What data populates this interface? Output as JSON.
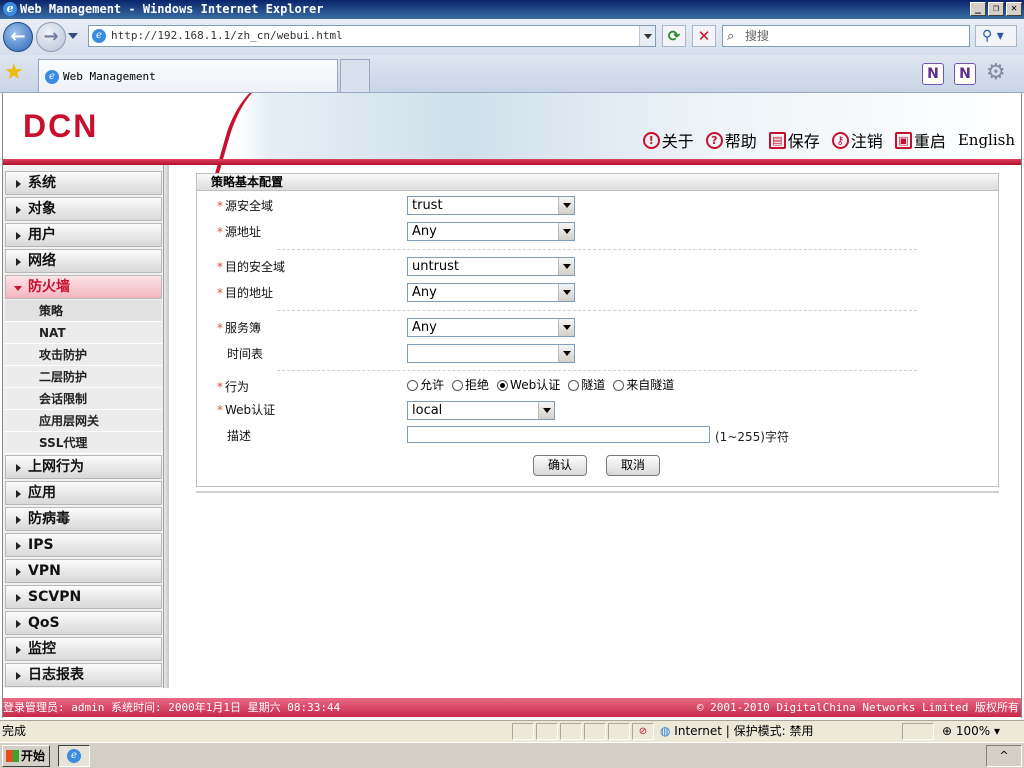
{
  "window": {
    "title": "Web Management - Windows Internet Explorer",
    "controls": [
      "_",
      "❐",
      "✕"
    ]
  },
  "browser": {
    "address": "http://192.168.1.1/zh_cn/webui.html",
    "search_placeholder": "搜搜",
    "tab_title": "Web Management"
  },
  "header": {
    "logo": "DCN",
    "links": [
      {
        "label": "关于",
        "icon": "!"
      },
      {
        "label": "帮助",
        "icon": "?"
      },
      {
        "label": "保存",
        "icon": "▤"
      },
      {
        "label": "注销",
        "icon": "⚷"
      },
      {
        "label": "重启",
        "icon": "▣"
      }
    ],
    "english": "English"
  },
  "sidebar": {
    "items": [
      {
        "label": "系统"
      },
      {
        "label": "对象"
      },
      {
        "label": "用户"
      },
      {
        "label": "网络"
      },
      {
        "label": "防火墙"
      },
      {
        "label": "上网行为"
      },
      {
        "label": "应用"
      },
      {
        "label": "防病毒"
      },
      {
        "label": "IPS"
      },
      {
        "label": "VPN"
      },
      {
        "label": "SCVPN"
      },
      {
        "label": "QoS"
      },
      {
        "label": "监控"
      },
      {
        "label": "日志报表"
      }
    ],
    "subitems": [
      "策略",
      "NAT",
      "攻击防护",
      "二层防护",
      "会话限制",
      "应用层网关",
      "SSL代理"
    ]
  },
  "form": {
    "title": "策略基本配置",
    "fields": {
      "src_zone": {
        "label": "源安全域",
        "value": "trust"
      },
      "src_addr": {
        "label": "源地址",
        "value": "Any"
      },
      "dst_zone": {
        "label": "目的安全域",
        "value": "untrust"
      },
      "dst_addr": {
        "label": "目的地址",
        "value": "Any"
      },
      "service": {
        "label": "服务簿",
        "value": "Any"
      },
      "schedule": {
        "label": "时间表",
        "value": ""
      },
      "action": {
        "label": "行为",
        "options": [
          "允许",
          "拒绝",
          "Web认证",
          "隧道",
          "来自隧道"
        ],
        "selected": "Web认证"
      },
      "web_auth": {
        "label": "Web认证",
        "value": "local"
      },
      "description": {
        "label": "描述",
        "value": "",
        "hint": "(1~255)字符"
      }
    },
    "required_mark": "*",
    "buttons": {
      "ok": "确认",
      "cancel": "取消"
    }
  },
  "footer": {
    "left": "登录管理员: admin 系统时间: 2000年1月1日 星期六 08:33:44",
    "right": "© 2001-2010 DigitalChina Networks Limited 版权所有"
  },
  "statusbar": {
    "status": "完成",
    "zone": "Internet | 保护模式: 禁用",
    "zoom": "100%"
  },
  "taskbar": {
    "start": "开始"
  }
}
